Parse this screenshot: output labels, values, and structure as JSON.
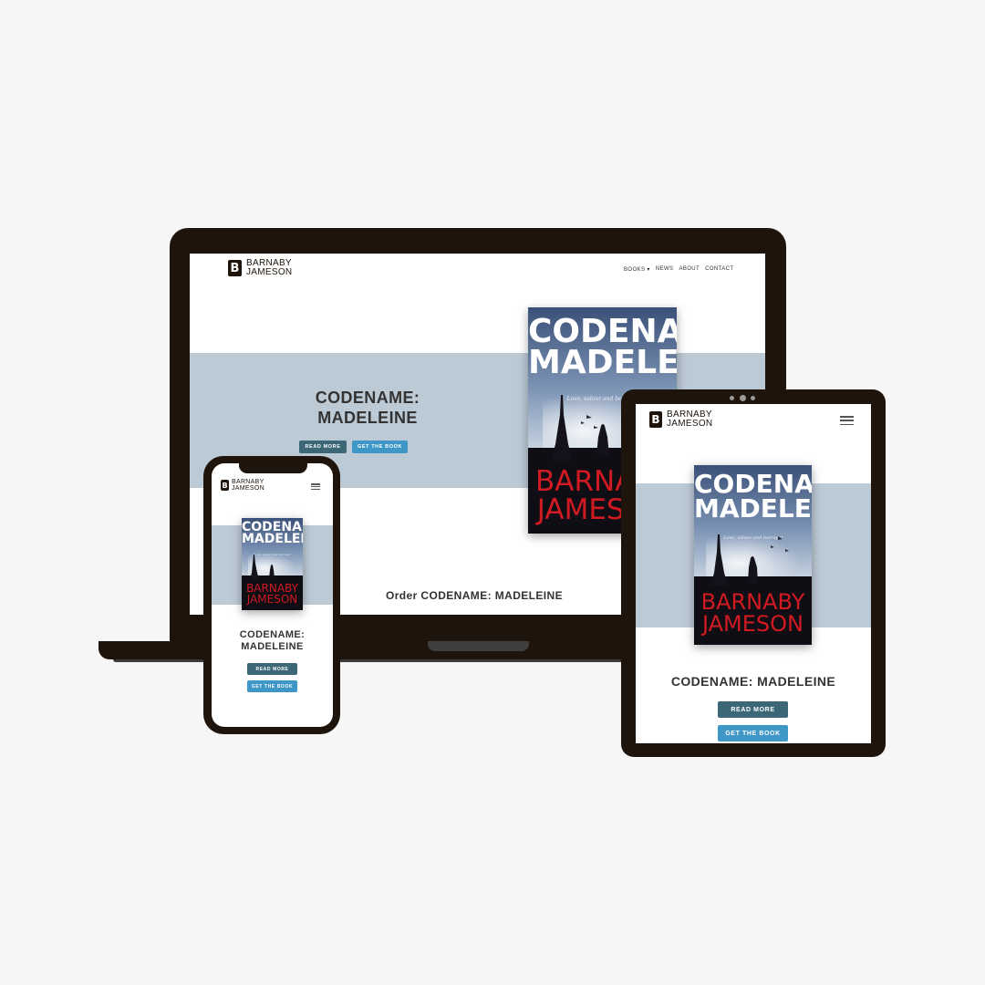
{
  "brand": {
    "first": "BARNABY",
    "last": "JAMESON",
    "mark": "B"
  },
  "nav": {
    "items": [
      "BOOKS ▾",
      "NEWS",
      "ABOUT",
      "CONTACT"
    ]
  },
  "hero": {
    "title_line1": "CODENAME:",
    "title_line2": "MADELEINE",
    "title_single": "CODENAME: MADELEINE",
    "read_more": "READ MORE",
    "get_book": "GET THE BOOK"
  },
  "book": {
    "cover_line1": "CODENAME:",
    "cover_line2": "MADELEINE",
    "tagline": "Love, valour and betrayal",
    "author_line1": "BARNABY",
    "author_line2": "JAMESON"
  },
  "order": {
    "heading": "Order CODENAME: MADELEINE"
  },
  "colors": {
    "frame": "#1e140b",
    "band": "#bccad6",
    "btn_dark": "#3c6777",
    "btn_light": "#3e97c7",
    "author_red": "#d11a22"
  },
  "icons": {
    "menu": "hamburger-menu-icon",
    "logo": "brand-logo-icon"
  }
}
